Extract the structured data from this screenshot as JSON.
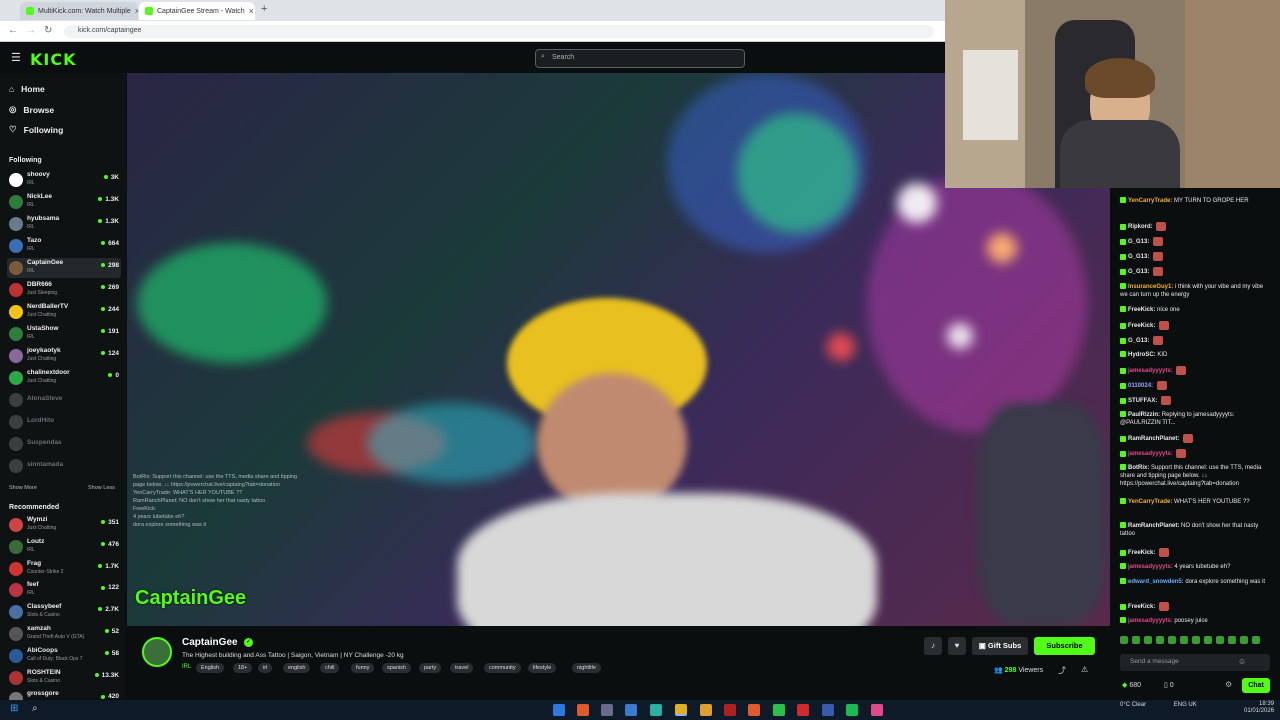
{
  "browser": {
    "tabs": [
      {
        "title": "MultiKick.com: Watch Multiple"
      },
      {
        "title": "CaptainGee Stream - Watch"
      }
    ],
    "url": "kick.com/captaingee"
  },
  "header": {
    "logo": "KICK",
    "search_placeholder": "Search"
  },
  "nav": {
    "items": [
      {
        "label": "Home",
        "icon": "home-icon"
      },
      {
        "label": "Browse",
        "icon": "compass-icon"
      },
      {
        "label": "Following",
        "icon": "heart-icon"
      }
    ]
  },
  "following": {
    "title": "Following",
    "channels": [
      {
        "name": "shoovy",
        "sub": "IRL",
        "viewers": "3K",
        "color": "#ffffff"
      },
      {
        "name": "NickLee",
        "sub": "IRL",
        "viewers": "1.3K",
        "color": "#2f7d3a"
      },
      {
        "name": "hyubsama",
        "sub": "IRL",
        "viewers": "1.3K",
        "color": "#6a7b8c"
      },
      {
        "name": "Tazo",
        "sub": "IRL",
        "viewers": "664",
        "color": "#3b6fb5"
      },
      {
        "name": "CaptainGee",
        "sub": "IRL",
        "viewers": "298",
        "color": "#7a5a3a"
      },
      {
        "name": "DBR666",
        "sub": "Just Sleeping",
        "viewers": "269",
        "color": "#b33"
      },
      {
        "name": "NerdBallerTV",
        "sub": "Just Chatting",
        "viewers": "244",
        "color": "#f0c419"
      },
      {
        "name": "UstaShow",
        "sub": "IRL",
        "viewers": "191",
        "color": "#2f7d3a"
      },
      {
        "name": "joeykaotyk",
        "sub": "Just Chatting",
        "viewers": "124",
        "color": "#8a6a9a"
      },
      {
        "name": "chalinextdoor",
        "sub": "Just Chatting",
        "viewers": "0",
        "color": "#2aa84a"
      }
    ],
    "offline": [
      {
        "name": "AlonaSteve"
      },
      {
        "name": "LordHito"
      },
      {
        "name": "Suspendas"
      },
      {
        "name": "sinntamada"
      }
    ],
    "show_more": "Show More",
    "show_less": "Show Less"
  },
  "recommended": {
    "title": "Recommended",
    "channels": [
      {
        "name": "Wymzi",
        "sub": "Just Chatting",
        "viewers": "351",
        "color": "#c44"
      },
      {
        "name": "Loutz",
        "sub": "IRL",
        "viewers": "476",
        "color": "#3a6a3a"
      },
      {
        "name": "Frag",
        "sub": "Counter-Strike 2",
        "viewers": "1.7K",
        "color": "#c33"
      },
      {
        "name": "feef",
        "sub": "IRL",
        "viewers": "122",
        "color": "#b34"
      },
      {
        "name": "Classybeef",
        "sub": "Slots & Casino",
        "viewers": "2.7K",
        "color": "#4a6fa0"
      },
      {
        "name": "xamzah",
        "sub": "Grand Theft Auto V (GTA)",
        "viewers": "52",
        "color": "#555"
      },
      {
        "name": "AbiCoops",
        "sub": "Call of Duty: Black Ops 7",
        "viewers": "58",
        "color": "#2a5a9a"
      },
      {
        "name": "ROSHTEIN",
        "sub": "Slots & Casino",
        "viewers": "13.3K",
        "color": "#a33"
      },
      {
        "name": "grossgore",
        "sub": "",
        "viewers": "420",
        "color": "#777"
      }
    ]
  },
  "video": {
    "watermark": "CaptainGee",
    "overlay_lines": [
      "BotRix: Support this channel: use the TTS, media share and tipping",
      "page below. ↓↓ https://powerchat.live/captaing?tab=donation",
      "YenCarryTrade: WHAT'S HER YOUTUBE ??",
      "RamRanchPlanet: NO don't show her that nasty tattoo",
      "FreeKick:",
      "4 years lubetube eh?",
      "dora explore something was it"
    ]
  },
  "stream": {
    "streamer": "CaptainGee",
    "title": "The Highest building and Ass Tattoo | Saigon, Vietnam | NY Challenge -20 kg",
    "category": "IRL",
    "tags": [
      "English",
      "18+",
      "irl",
      "english",
      "chill",
      "funny",
      "spanish",
      "party",
      "travel",
      "community",
      "lifestyle",
      "nightlife"
    ],
    "gift_subs": "Gift Subs",
    "subscribe": "Subscribe",
    "viewers_count": "298",
    "viewers_label": "Viewers"
  },
  "chat": {
    "messages": [
      {
        "user": "YenCarryTrade:",
        "text": "MY TURN TO GROPE HER",
        "color": "#f2b233"
      },
      {
        "user": "Ripkord:",
        "text": "",
        "color": "#e8e8e8"
      },
      {
        "user": "G_G13:",
        "text": "",
        "color": "#e8e8e8"
      },
      {
        "user": "G_G13:",
        "text": "",
        "color": "#e8e8e8"
      },
      {
        "user": "G_G13:",
        "text": "",
        "color": "#e8e8e8"
      },
      {
        "user": "InsuranceGuy1:",
        "text": "i think with your vibe and my vibe we can turn up the energy",
        "color": "#f2b233"
      },
      {
        "user": "FreeKick:",
        "text": "nice one",
        "color": "#e8e8e8"
      },
      {
        "user": "FreeKick:",
        "text": "",
        "color": "#e8e8e8"
      },
      {
        "user": "G_G13:",
        "text": "",
        "color": "#e8e8e8"
      },
      {
        "user": "HydroSC:",
        "text": "KID",
        "color": "#e8e8e8"
      },
      {
        "user": "jamesadyyyyts:",
        "text": "",
        "color": "#e04a8a"
      },
      {
        "user": "0110024:",
        "text": "",
        "color": "#9aa0ff"
      },
      {
        "user": "STUFFAX:",
        "text": "",
        "color": "#e8e8e8"
      },
      {
        "user": "PaulRizzin:",
        "text": "Replying to jamesadyyyyts: @PAULRIZZIN TIT...",
        "color": "#e8e8e8"
      },
      {
        "user": "RamRanchPlanet:",
        "text": "",
        "color": "#e8e8e8"
      },
      {
        "user": "jamesadyyyyts:",
        "text": "",
        "color": "#e04a8a"
      },
      {
        "user": "BotRix:",
        "text": "Support this channel: use the TTS, media share and tipping page below. ↓↓ https://powerchat.live/captaing?tab=donation",
        "color": "#e8e8e8"
      },
      {
        "user": "YenCarryTrade:",
        "text": "WHAT'S HER YOUTUBE ??",
        "color": "#f2b233"
      },
      {
        "user": "RamRanchPlanet:",
        "text": "NO don't show her that nasty tattoo",
        "color": "#e8e8e8"
      },
      {
        "user": "FreeKick:",
        "text": "",
        "color": "#e8e8e8"
      },
      {
        "user": "jamesadyyyyts:",
        "text": "4 years lubetube eh?",
        "color": "#e04a8a"
      },
      {
        "user": "edward_snowden5:",
        "text": "dora explore something was it",
        "color": "#6ab0ff"
      },
      {
        "user": "FreeKick:",
        "text": "",
        "color": "#e8e8e8"
      },
      {
        "user": "jamesadyyyyts:",
        "text": "poosey juice",
        "color": "#e04a8a"
      }
    ],
    "input_placeholder": "Send a message",
    "points": "680",
    "count": "0",
    "send_label": "Chat"
  },
  "taskbar": {
    "weather": "0°C  Clear",
    "lang": "ENG UK",
    "time": "18:39",
    "date": "01/01/2026"
  },
  "colors": {
    "accent": "#53fc18",
    "bg": "#0b0e0f"
  }
}
